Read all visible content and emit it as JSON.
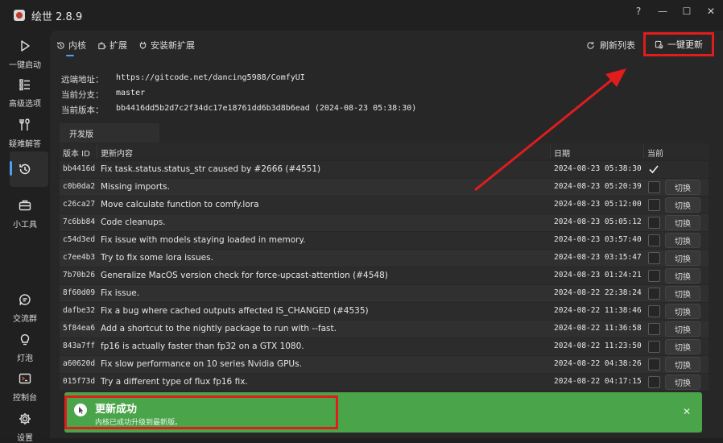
{
  "window": {
    "title": "绘世 2.8.9",
    "help": "?",
    "minimize": "—",
    "maximize": "☐",
    "close": "✕"
  },
  "sidebar": {
    "items": [
      {
        "label": "一键启动",
        "icon": "play-icon"
      },
      {
        "label": "高级选项",
        "icon": "list-icon"
      },
      {
        "label": "疑难解答",
        "icon": "wrench-icon"
      },
      {
        "label": "",
        "icon": "history-icon",
        "active": true
      },
      {
        "label": "小工具",
        "icon": "toolbox-icon"
      },
      {
        "label": "交流群",
        "icon": "chat-icon"
      },
      {
        "label": "灯泡",
        "icon": "bulb-icon"
      },
      {
        "label": "控制台",
        "icon": "console-icon"
      },
      {
        "label": "设置",
        "icon": "gear-icon"
      }
    ]
  },
  "tabs": [
    {
      "label": "内核",
      "icon": "history-icon",
      "active": true
    },
    {
      "label": "扩展",
      "icon": "puzzle-icon"
    },
    {
      "label": "安装新扩展",
      "icon": "plug-icon"
    }
  ],
  "actions": {
    "refresh_label": "刷新列表",
    "update_label": "一键更新"
  },
  "info": {
    "remote_label": "远端地址：",
    "remote_value": "https://gitcode.net/dancing5988/ComfyUI",
    "branch_label": "当前分支：",
    "branch_value": "master",
    "version_label": "当前版本：",
    "version_value": "bb4416dd5b2d7c2f34dc17e18761dd6b3d8b6ead (2024-08-23 05:38:30)"
  },
  "branch_tab": "开发版",
  "table": {
    "headers": {
      "id": "版本 ID",
      "message": "更新内容",
      "date": "日期",
      "current": "当前"
    },
    "switch_label": "切换",
    "rows": [
      {
        "id": "bb4416d",
        "message": "Fix task.status.status_str caused by #2666 (#4551)",
        "date": "2024-08-23 05:38:30",
        "current": true
      },
      {
        "id": "c0b0da2",
        "message": "Missing imports.",
        "date": "2024-08-23 05:20:39",
        "current": false
      },
      {
        "id": "c26ca27",
        "message": "Move calculate function to comfy.lora",
        "date": "2024-08-23 05:12:00",
        "current": false
      },
      {
        "id": "7c6bb84",
        "message": "Code cleanups.",
        "date": "2024-08-23 05:05:12",
        "current": false
      },
      {
        "id": "c54d3ed",
        "message": "Fix issue with models staying loaded in memory.",
        "date": "2024-08-23 03:57:40",
        "current": false
      },
      {
        "id": "c7ee4b3",
        "message": "Try to fix some lora issues.",
        "date": "2024-08-23 03:15:47",
        "current": false
      },
      {
        "id": "7b70b26",
        "message": "Generalize MacOS version check for force-upcast-attention (#4548)",
        "date": "2024-08-23 01:24:21",
        "current": false
      },
      {
        "id": "8f60d09",
        "message": "Fix issue.",
        "date": "2024-08-22 22:38:24",
        "current": false
      },
      {
        "id": "dafbe32",
        "message": "Fix a bug where cached outputs affected IS_CHANGED (#4535)",
        "date": "2024-08-22 11:38:46",
        "current": false
      },
      {
        "id": "5f84ea6",
        "message": "Add a shortcut to the nightly package to run with --fast.",
        "date": "2024-08-22 11:36:58",
        "current": false
      },
      {
        "id": "843a7ff",
        "message": "fp16 is actually faster than fp32 on a GTX 1080.",
        "date": "2024-08-22 11:23:50",
        "current": false
      },
      {
        "id": "a60620d",
        "message": "Fix slow performance on 10 series Nvidia GPUs.",
        "date": "2024-08-22 04:38:26",
        "current": false
      },
      {
        "id": "015f73d",
        "message": "Try a different type of flux fp16 fix.",
        "date": "2024-08-22 04:17:15",
        "current": false
      }
    ]
  },
  "toast": {
    "title": "更新成功",
    "message": "内核已成功升级到最新版。",
    "close": "✕"
  },
  "colors": {
    "accent": "#4aa3f0",
    "success": "#4aa44a",
    "highlight": "#e01c1c"
  }
}
